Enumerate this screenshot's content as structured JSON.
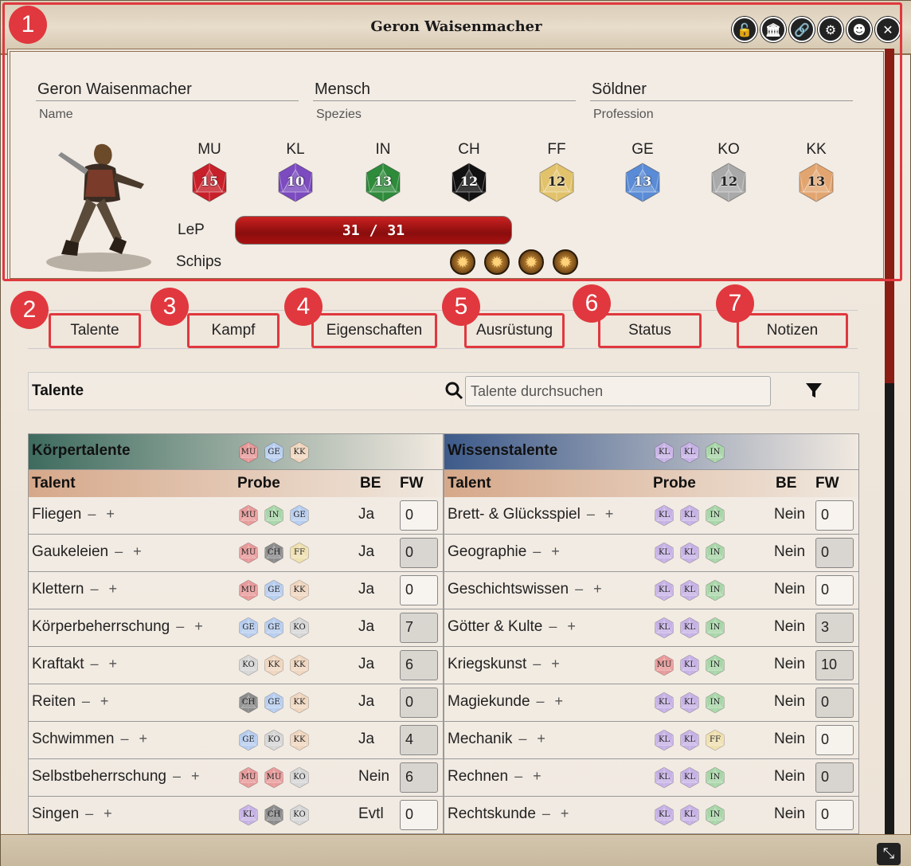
{
  "window": {
    "title": "Geron Waisenmacher"
  },
  "title_icons": [
    {
      "name": "lock-open-icon",
      "glyph": "🔓"
    },
    {
      "name": "bank-icon",
      "glyph": "🏛"
    },
    {
      "name": "link-icon",
      "glyph": "🔗"
    },
    {
      "name": "gear-icon",
      "glyph": "⚙"
    },
    {
      "name": "user-circle-icon",
      "glyph": "☻"
    },
    {
      "name": "close-icon",
      "glyph": "✕"
    }
  ],
  "markers": [
    "1",
    "2",
    "3",
    "4",
    "5",
    "6",
    "7"
  ],
  "character": {
    "name": "Geron Waisenmacher",
    "name_label": "Name",
    "species": "Mensch",
    "species_label": "Spezies",
    "profession": "Söldner",
    "profession_label": "Profession"
  },
  "attributes": [
    {
      "name": "MU",
      "value": "15",
      "color": "#c8202a"
    },
    {
      "name": "KL",
      "value": "10",
      "color": "#7b4bbf"
    },
    {
      "name": "IN",
      "value": "13",
      "color": "#2e8b3a"
    },
    {
      "name": "CH",
      "value": "12",
      "color": "#111111"
    },
    {
      "name": "FF",
      "value": "12",
      "color": "#e2c26a"
    },
    {
      "name": "GE",
      "value": "13",
      "color": "#5a8bd6"
    },
    {
      "name": "KO",
      "value": "12",
      "color": "#a9a9a9"
    },
    {
      "name": "KK",
      "value": "13",
      "color": "#e3a570"
    }
  ],
  "lep": {
    "label": "LeP",
    "current": "31",
    "separator": "/",
    "max": "31"
  },
  "schips": {
    "label": "Schips",
    "count": 4
  },
  "tabs": [
    "Talente",
    "Kampf",
    "Eigenschaften",
    "Ausrüstung",
    "Status",
    "Notizen"
  ],
  "search": {
    "title": "Talente",
    "placeholder": "Talente durchsuchen"
  },
  "chip_colors": {
    "MU": "#e89a9a",
    "KL": "#c7b2e6",
    "IN": "#a9d6a9",
    "CH": "#8c8c8c",
    "FF": "#efe0b0",
    "GE": "#b7cdef",
    "KO": "#d6d6d6",
    "KK": "#f0d6bf"
  },
  "col_headers": {
    "talent": "Talent",
    "probe": "Probe",
    "be": "BE",
    "fw": "FW"
  },
  "left_group": {
    "name": "Körpertalente",
    "chips": [
      "MU",
      "GE",
      "KK"
    ],
    "header_color": "#3d6b5e",
    "rows": [
      {
        "name": "Fliegen",
        "probe": [
          "MU",
          "IN",
          "GE"
        ],
        "be": "Ja",
        "fw": "0"
      },
      {
        "name": "Gaukeleien",
        "probe": [
          "MU",
          "CH",
          "FF"
        ],
        "be": "Ja",
        "fw": "0"
      },
      {
        "name": "Klettern",
        "probe": [
          "MU",
          "GE",
          "KK"
        ],
        "be": "Ja",
        "fw": "0"
      },
      {
        "name": "Körperbeherrschung",
        "probe": [
          "GE",
          "GE",
          "KO"
        ],
        "be": "Ja",
        "fw": "7"
      },
      {
        "name": "Kraftakt",
        "probe": [
          "KO",
          "KK",
          "KK"
        ],
        "be": "Ja",
        "fw": "6"
      },
      {
        "name": "Reiten",
        "probe": [
          "CH",
          "GE",
          "KK"
        ],
        "be": "Ja",
        "fw": "0"
      },
      {
        "name": "Schwimmen",
        "probe": [
          "GE",
          "KO",
          "KK"
        ],
        "be": "Ja",
        "fw": "4"
      },
      {
        "name": "Selbstbeherrschung",
        "probe": [
          "MU",
          "MU",
          "KO"
        ],
        "be": "Nein",
        "fw": "6"
      },
      {
        "name": "Singen",
        "probe": [
          "KL",
          "CH",
          "KO"
        ],
        "be": "Evtl",
        "fw": "0"
      }
    ]
  },
  "right_group": {
    "name": "Wissenstalente",
    "chips": [
      "KL",
      "KL",
      "IN"
    ],
    "header_color": "#3d5a8a",
    "rows": [
      {
        "name": "Brett- & Glücksspiel",
        "probe": [
          "KL",
          "KL",
          "IN"
        ],
        "be": "Nein",
        "fw": "0"
      },
      {
        "name": "Geographie",
        "probe": [
          "KL",
          "KL",
          "IN"
        ],
        "be": "Nein",
        "fw": "0"
      },
      {
        "name": "Geschichtswissen",
        "probe": [
          "KL",
          "KL",
          "IN"
        ],
        "be": "Nein",
        "fw": "0"
      },
      {
        "name": "Götter & Kulte",
        "probe": [
          "KL",
          "KL",
          "IN"
        ],
        "be": "Nein",
        "fw": "3"
      },
      {
        "name": "Kriegskunst",
        "probe": [
          "MU",
          "KL",
          "IN"
        ],
        "be": "Nein",
        "fw": "10"
      },
      {
        "name": "Magiekunde",
        "probe": [
          "KL",
          "KL",
          "IN"
        ],
        "be": "Nein",
        "fw": "0"
      },
      {
        "name": "Mechanik",
        "probe": [
          "KL",
          "KL",
          "FF"
        ],
        "be": "Nein",
        "fw": "0"
      },
      {
        "name": "Rechnen",
        "probe": [
          "KL",
          "KL",
          "IN"
        ],
        "be": "Nein",
        "fw": "0"
      },
      {
        "name": "Rechtskunde",
        "probe": [
          "KL",
          "KL",
          "IN"
        ],
        "be": "Nein",
        "fw": "0"
      }
    ]
  },
  "pm_label": "– +"
}
